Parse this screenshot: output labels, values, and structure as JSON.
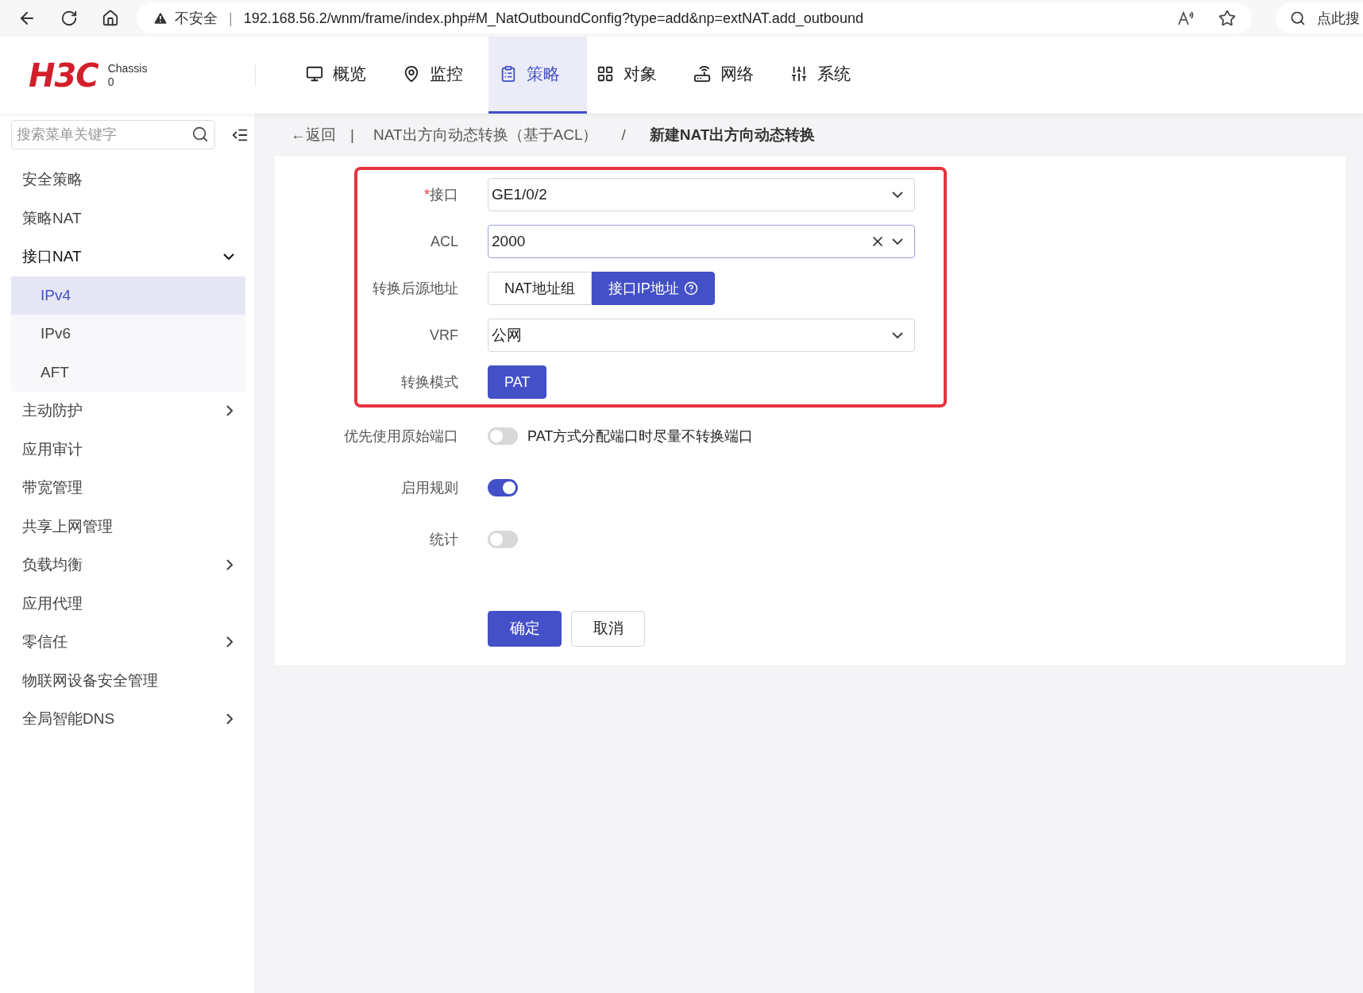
{
  "browser": {
    "security": "不安全",
    "separator": "|",
    "url": "192.168.56.2/wnm/frame/index.php#M_NatOutboundConfig?type=add&np=extNAT.add_outbound",
    "search_label": "点此搜"
  },
  "header": {
    "logo": "H3C",
    "chassis_label": "Chassis",
    "chassis_value": "0",
    "tabs": [
      {
        "label": "概览",
        "selected": false
      },
      {
        "label": "监控",
        "selected": false
      },
      {
        "label": "策略",
        "selected": true
      },
      {
        "label": "对象",
        "selected": false
      },
      {
        "label": "网络",
        "selected": false
      },
      {
        "label": "系统",
        "selected": false
      }
    ]
  },
  "sidebar": {
    "search": {
      "placeholder": "搜索菜单关键字"
    },
    "items": [
      {
        "label": "安全策略"
      },
      {
        "label": "策略NAT"
      },
      {
        "label": "接口NAT",
        "expanded": true,
        "children": [
          {
            "label": "IPv4",
            "selected": true
          },
          {
            "label": "IPv6",
            "selected": false
          },
          {
            "label": "AFT",
            "selected": false
          }
        ]
      },
      {
        "label": "主动防护",
        "expanded": false
      },
      {
        "label": "应用审计"
      },
      {
        "label": "带宽管理"
      },
      {
        "label": "共享上网管理"
      },
      {
        "label": "负载均衡",
        "expanded": false
      },
      {
        "label": "应用代理"
      },
      {
        "label": "零信任",
        "expanded": false
      },
      {
        "label": "物联网设备安全管理"
      },
      {
        "label": "全局智能DNS",
        "expanded": false
      }
    ]
  },
  "breadcrumb": {
    "back": "←返回",
    "back_separator": "|",
    "parent": "NAT出方向动态转换（基于ACL）",
    "separator": "/",
    "current": "新建NAT出方向动态转换"
  },
  "form": {
    "highlighted_fields": [
      {
        "kind": "select",
        "required_mark": "*",
        "label": "接口",
        "value": "GE1/0/2"
      },
      {
        "kind": "select",
        "label": "ACL",
        "value": "2000",
        "clearable": true
      },
      {
        "kind": "segmented",
        "label": "转换后源地址",
        "options": [
          {
            "label": "NAT地址组",
            "selected": false,
            "help": false
          },
          {
            "label": "接口IP地址",
            "selected": true,
            "help": true
          }
        ]
      },
      {
        "kind": "select",
        "label": "VRF",
        "value": "公网"
      },
      {
        "kind": "segmented",
        "label": "转换模式",
        "options": [
          {
            "label": "PAT",
            "selected": true,
            "help": false
          }
        ]
      }
    ],
    "fields": [
      {
        "kind": "switch",
        "label": "优先使用原始端口",
        "on": false,
        "hint": "PAT方式分配端口时尽量不转换端口"
      },
      {
        "kind": "switch",
        "label": "启用规则",
        "on": true
      },
      {
        "kind": "switch",
        "label": "统计",
        "on": false
      }
    ],
    "buttons": [
      {
        "label": "确定",
        "kind": "primary"
      },
      {
        "label": "取消",
        "kind": "default"
      }
    ]
  }
}
